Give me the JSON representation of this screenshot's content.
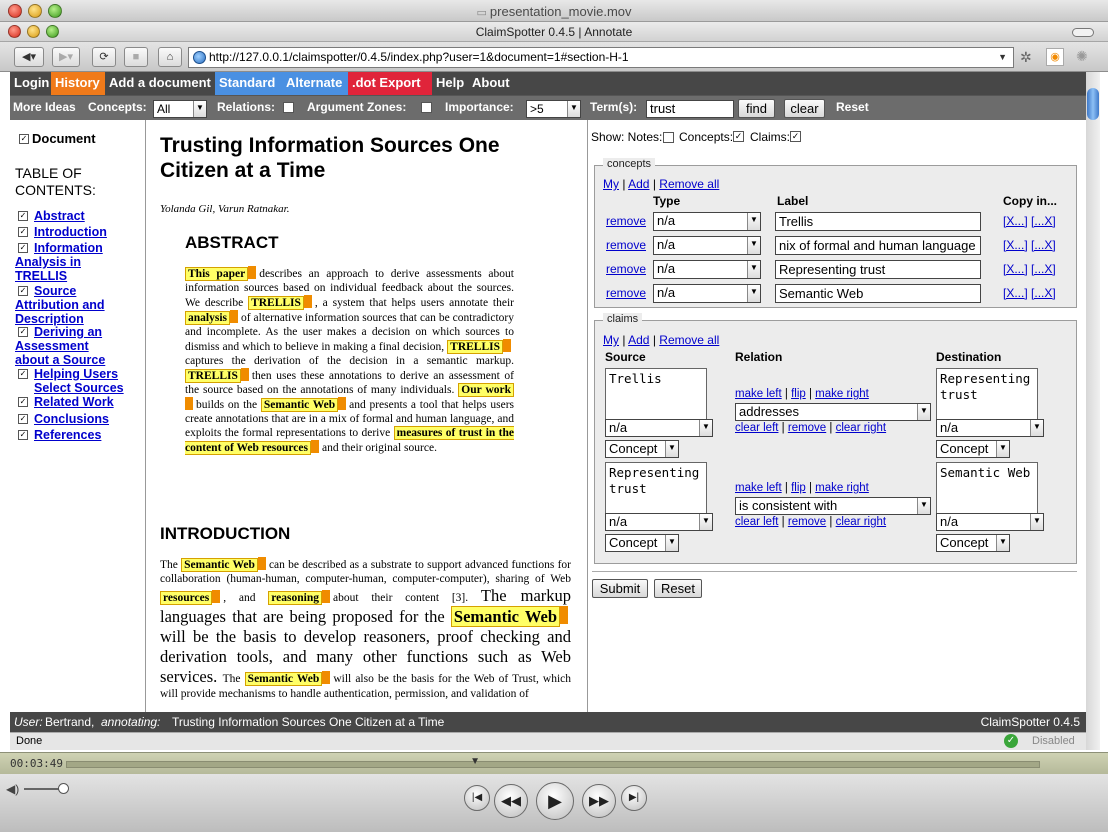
{
  "outer_window": {
    "title": "presentation_movie.mov"
  },
  "browser": {
    "title": "ClaimSpotter 0.4.5 | Annotate",
    "url": "http://127.0.0.1/claimspotter/0.4.5/index.php?user=1&document=1#section-H-1"
  },
  "menu": {
    "items": [
      {
        "label": "Login",
        "color": "#474747"
      },
      {
        "label": "History",
        "color": "#f07a1a"
      },
      {
        "label": "Add a document",
        "color": "#474747"
      },
      {
        "label": "Standard",
        "color": "#4a90e2"
      },
      {
        "label": "Alternate",
        "color": "#4a90e2"
      },
      {
        "label": ".dot Export",
        "color": "#e0243a"
      },
      {
        "label": "Help",
        "color": "#474747"
      },
      {
        "label": "About",
        "color": "#474747"
      }
    ]
  },
  "toolbar": {
    "more_ideas": "More Ideas",
    "concepts_label": "Concepts:",
    "concepts_value": "All",
    "relations_label": "Relations:",
    "argument_zones_label": "Argument Zones:",
    "importance_label": "Importance:",
    "importance_value": ">5",
    "terms_label": "Term(s):",
    "terms_value": "trust",
    "find_label": "find",
    "clear_label": "clear",
    "reset_label": "Reset"
  },
  "toc": {
    "document_label": "Document",
    "heading": "TABLE OF CONTENTS:",
    "items": [
      "Abstract",
      "Introduction",
      "Information Analysis in TRELLIS",
      "Source Attribution and Description",
      "Deriving an Assessment about a Source",
      "Helping Users Select Sources",
      "Related Work",
      "Conclusions",
      "References"
    ]
  },
  "document": {
    "title": "Trusting Information Sources One Citizen at a Time",
    "authors": "Yolanda Gil, Varun Ratnakar.",
    "abstract_heading": "ABSTRACT",
    "intro_heading": "INTRODUCTION",
    "abstract": {
      "h1": "This paper",
      "t1": "describes an approach to derive assessments about information sources based on individual feedback about the sources. We describe",
      "h2": "TRELLIS",
      "t2": ", a system that helps users annotate their",
      "h3": "analysis",
      "t3": "of alternative information sources that can be contradictory and incomplete. As the user makes a decision on which sources to dismiss and which to believe in making a final decision,",
      "h4": "TRELLIS",
      "t4": "captures the derivation of the decision in a semantic markup.",
      "h5": "TRELLIS",
      "t5": "then uses these annotations to derive an assessment of the source based on the annotations of many individuals.",
      "h6": "Our work",
      "t6": "builds on the",
      "h7": "Semantic Web",
      "t7": "and presents a tool that helps users create annotations that are in a mix of formal and human language, and exploits the formal representations to derive",
      "h8": "measures of trust in the content of Web resources",
      "t8": "and their original source."
    },
    "intro": {
      "t0": "The",
      "h1": "Semantic Web",
      "t1": "can be described as a substrate to support advanced functions for collaboration (human-human, computer-human, computer-computer), sharing of Web",
      "h2": "resources",
      "t2": ", and",
      "h3": "reasoning",
      "t3": "about their content",
      "ref": "[3].",
      "big1": "The markup languages that are being proposed for the",
      "big_h": "Semantic Web",
      "big2": "will be the basis to develop reasoners, proof checking and derivation tools, and many other functions such as Web services.",
      "t4": "The",
      "h4": "Semantic Web",
      "t5": "will also be the basis for the Web of Trust, which will provide mechanisms to handle authentication, permission, and validation of"
    }
  },
  "show_options": {
    "label": "Show: Notes:",
    "concepts": "Concepts:",
    "claims": "Claims:"
  },
  "concepts": {
    "legend": "concepts",
    "my": "My",
    "add": "Add",
    "remove_all": "Remove all",
    "col_type": "Type",
    "col_label": "Label",
    "col_copy": "Copy in...",
    "remove": "remove",
    "copy1": "[X...]",
    "copy2": "[...X]",
    "rows": [
      {
        "type": "n/a",
        "label": "Trellis"
      },
      {
        "type": "n/a",
        "label": "nix of formal and human language"
      },
      {
        "type": "n/a",
        "label": "Representing trust"
      },
      {
        "type": "n/a",
        "label": "Semantic Web"
      }
    ]
  },
  "claims": {
    "legend": "claims",
    "my": "My",
    "add": "Add",
    "remove_all": "Remove all",
    "col_source": "Source",
    "col_relation": "Relation",
    "col_destination": "Destination",
    "make_left": "make left",
    "flip": "flip",
    "make_right": "make right",
    "clear_left": "clear left",
    "remove": "remove",
    "clear_right": "clear right",
    "rows": [
      {
        "source": "Trellis",
        "source_qual": "n/a",
        "source_kind": "Concept",
        "relation": "addresses",
        "dest": "Representing trust",
        "dest_qual": "n/a",
        "dest_kind": "Concept"
      },
      {
        "source": "Representing trust",
        "source_qual": "n/a",
        "source_kind": "Concept",
        "relation": "is consistent with",
        "dest": "Semantic Web",
        "dest_qual": "n/a",
        "dest_kind": "Concept"
      }
    ]
  },
  "form": {
    "submit": "Submit",
    "reset": "Reset"
  },
  "footer": {
    "user_label": "User:",
    "user": "Bertrand,",
    "annotating_label": "annotating:",
    "doc": "Trusting Information Sources One Citizen at a Time",
    "version": "ClaimSpotter 0.4.5"
  },
  "status": {
    "text": "Done",
    "disabled": "Disabled"
  },
  "player": {
    "time": "00:03:49",
    "progress": 0.42
  }
}
